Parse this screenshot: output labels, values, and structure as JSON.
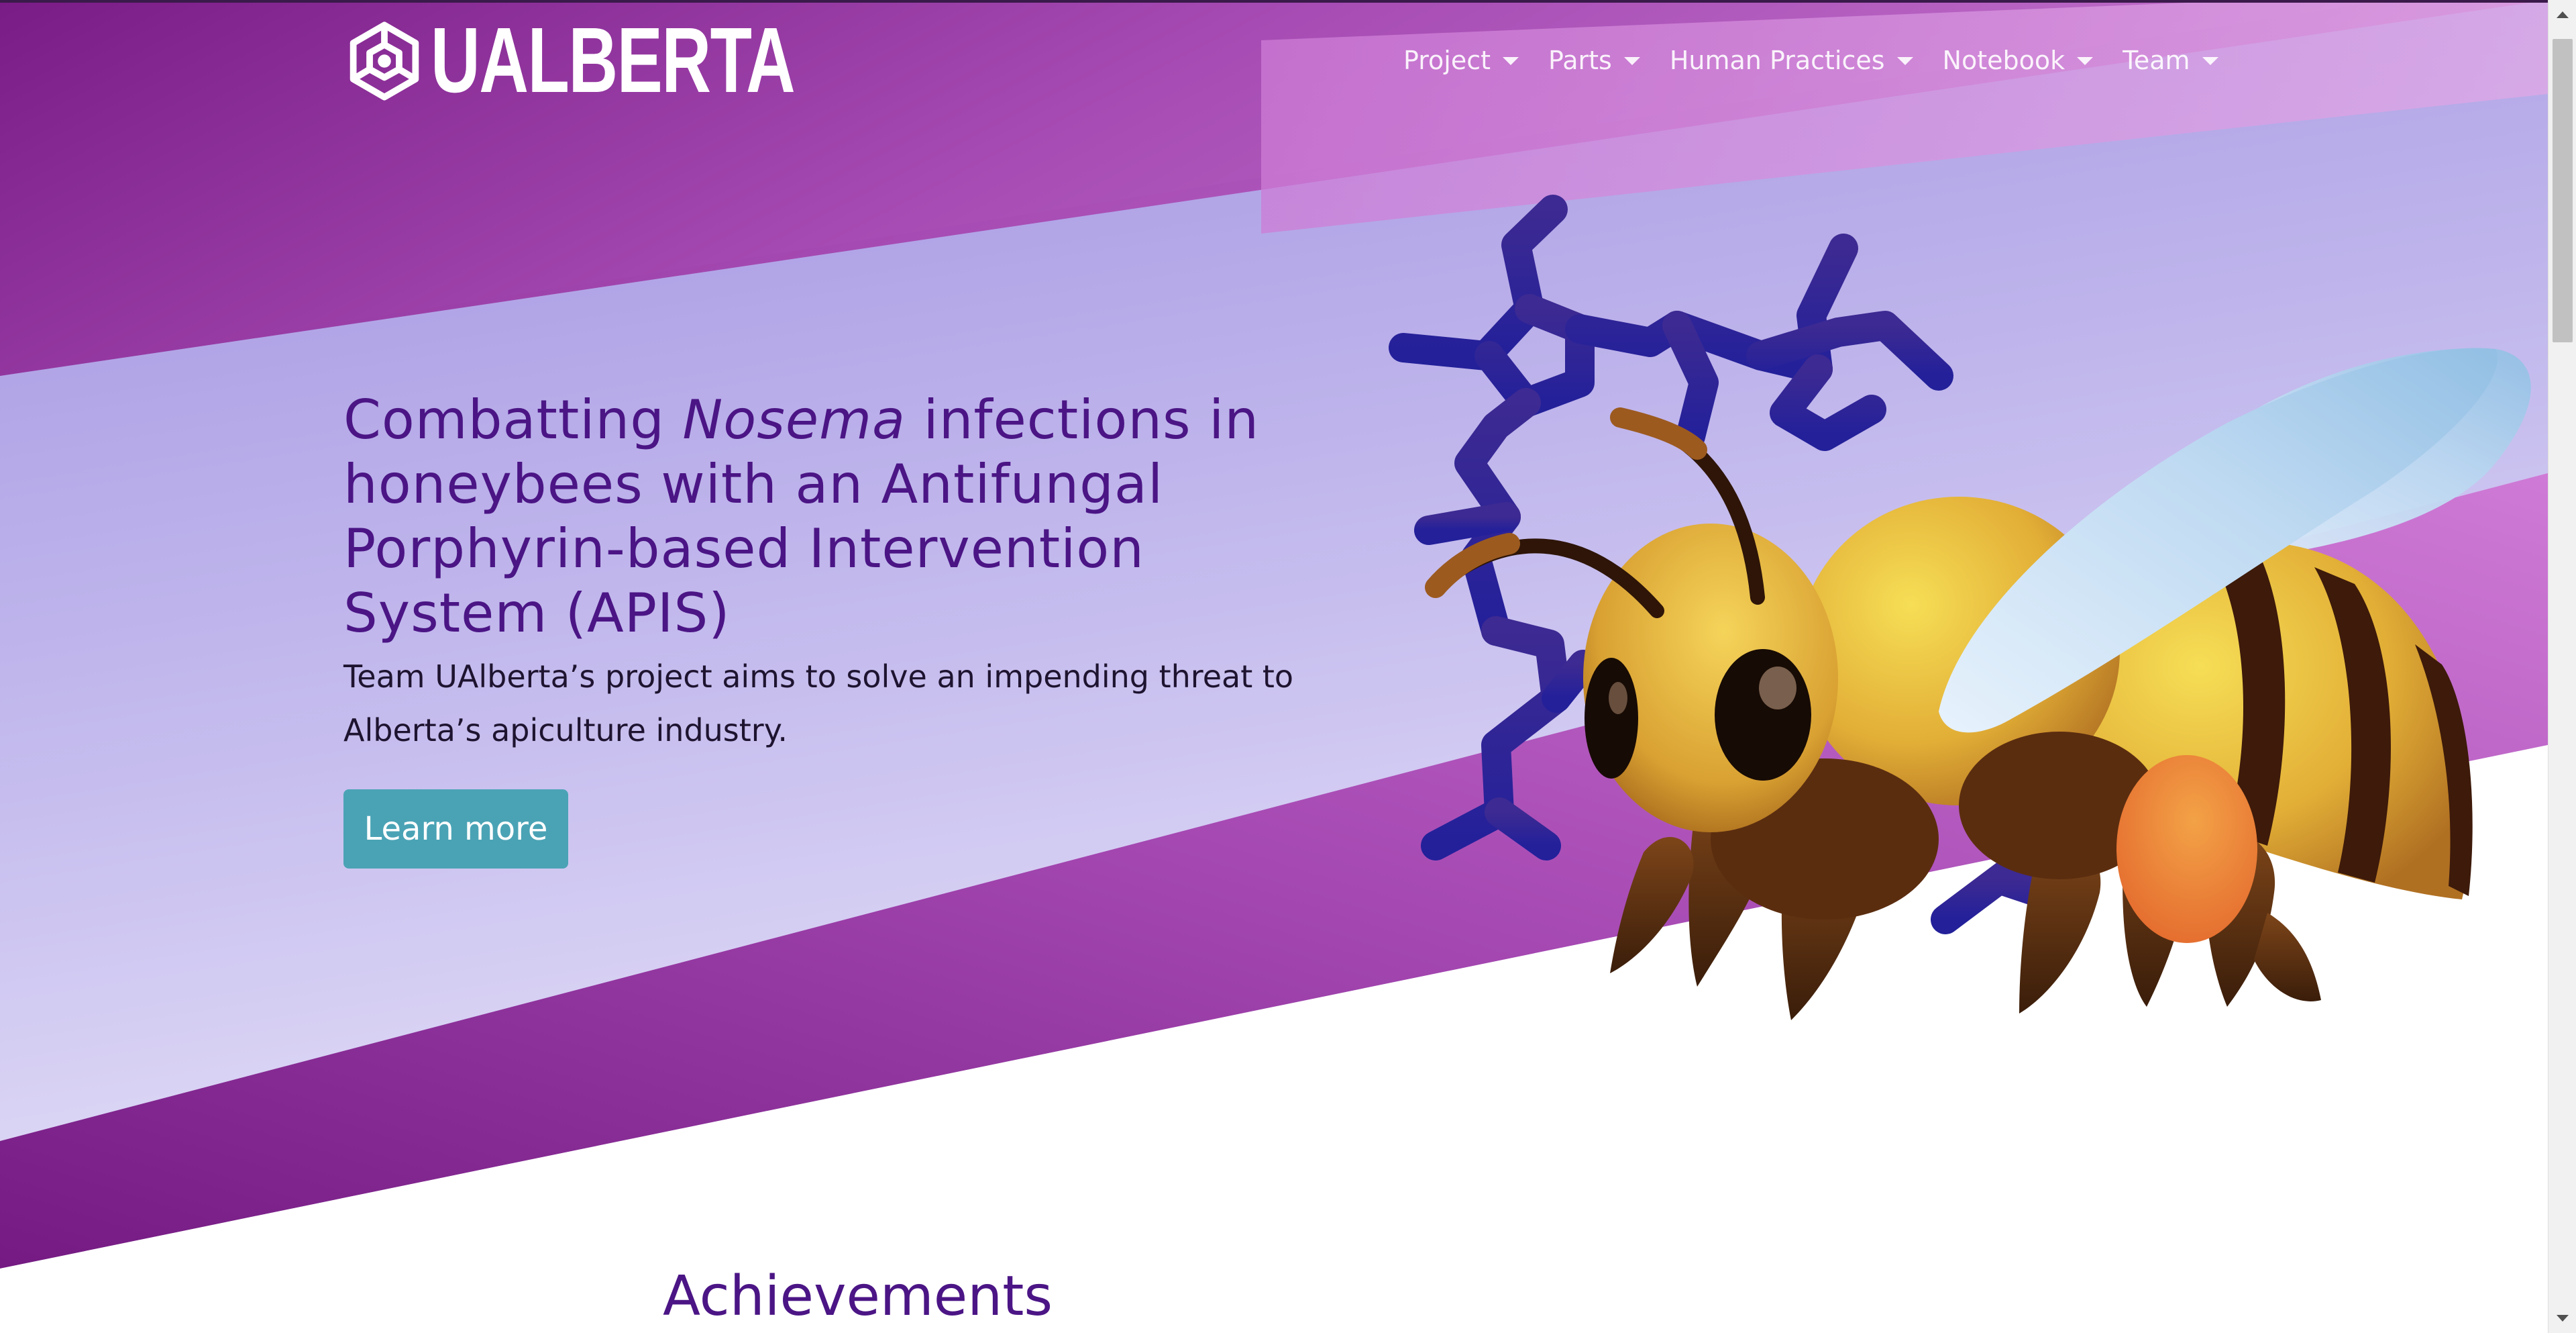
{
  "brand": {
    "logo_text": "UALBERTA"
  },
  "nav": {
    "items": [
      {
        "label": "Project"
      },
      {
        "label": "Parts"
      },
      {
        "label": "Human Practices"
      },
      {
        "label": "Notebook"
      },
      {
        "label": "Team"
      }
    ]
  },
  "hero": {
    "title_part1": "Combatting ",
    "title_italic": "Nosema",
    "title_part2": " infections in honeybees with an Antifungal Porphyrin-based Intervention System (APIS)",
    "subtitle": "Team UAlberta’s project aims to solve an impending threat to Alberta’s apiculture industry.",
    "cta_label": "Learn more"
  },
  "sections": {
    "achievements_title": "Achievements"
  },
  "colors": {
    "accent_purple": "#4b1585",
    "band_purple": "#8a2a98",
    "button_teal": "#4aa3b5",
    "molecule_indigo": "#3a2a9c"
  },
  "icons": {
    "logo": "molecule-hexagon-logo-icon",
    "dropdown": "caret-down-icon",
    "scroll_up": "arrow-up-icon",
    "scroll_down": "arrow-down-icon"
  }
}
